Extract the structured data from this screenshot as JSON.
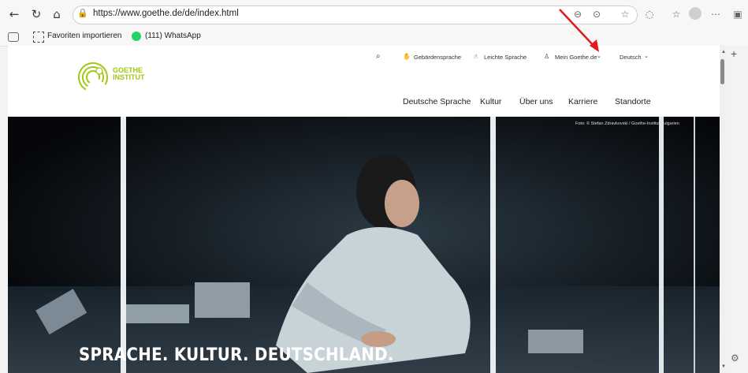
{
  "browser": {
    "url": "https://www.goethe.de/de/index.html",
    "bookmarks": [
      {
        "label": "Favoriten importieren"
      },
      {
        "label": "(111) WhatsApp"
      }
    ]
  },
  "site": {
    "logo": {
      "line1": "GOETHE",
      "line2": "INSTITUT"
    },
    "utility_nav": [
      "Gebärdensprache",
      "Leichte Sprache",
      "Mein Goethe.de",
      "Deutsch"
    ],
    "main_nav": [
      "Deutsche Sprache",
      "Kultur",
      "Über uns",
      "Karriere",
      "Standorte"
    ],
    "hero": {
      "headline": "SPRACHE. KULTUR. DEUTSCHLAND.",
      "credit": "Foto: © Stefan Zdravkovski / Goethe-Institut Bulgarien"
    }
  },
  "colors": {
    "brand_green": "#a0c814",
    "arrow_red": "#e11a1a"
  }
}
